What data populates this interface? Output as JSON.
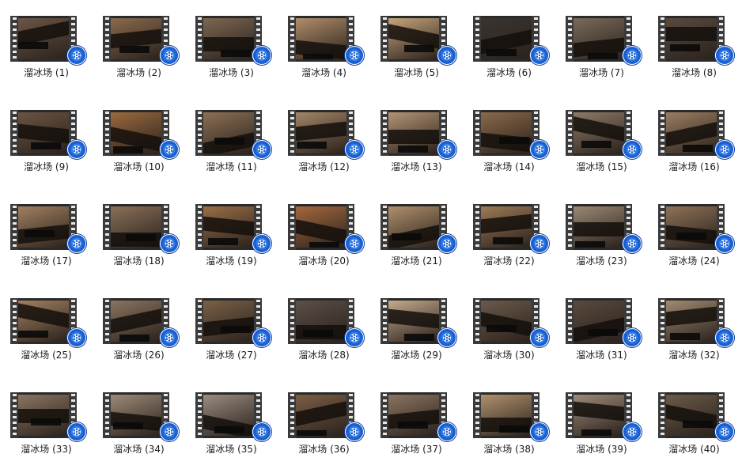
{
  "files": [
    {
      "label": "溜冰场 (1)",
      "tone": "#6b5646"
    },
    {
      "label": "溜冰场 (2)",
      "tone": "#8a6a4e"
    },
    {
      "label": "溜冰场 (3)",
      "tone": "#7c6652"
    },
    {
      "label": "溜冰场 (4)",
      "tone": "#b08d6a"
    },
    {
      "label": "溜冰场 (5)",
      "tone": "#c6a47c"
    },
    {
      "label": "溜冰场 (6)",
      "tone": "#3a3430"
    },
    {
      "label": "溜冰场 (7)",
      "tone": "#7a6a5a"
    },
    {
      "label": "溜冰场 (8)",
      "tone": "#5a4a3e"
    },
    {
      "label": "溜冰场 (9)",
      "tone": "#6a5444"
    },
    {
      "label": "溜冰场 (10)",
      "tone": "#9a6a3e"
    },
    {
      "label": "溜冰场 (11)",
      "tone": "#8c7056"
    },
    {
      "label": "溜冰场 (12)",
      "tone": "#a28566"
    },
    {
      "label": "溜冰场 (13)",
      "tone": "#b39474"
    },
    {
      "label": "溜冰场 (14)",
      "tone": "#8a6a4a"
    },
    {
      "label": "溜冰场 (15)",
      "tone": "#8d7a68"
    },
    {
      "label": "溜冰场 (16)",
      "tone": "#9b7e62"
    },
    {
      "label": "溜冰场 (17)",
      "tone": "#a08060"
    },
    {
      "label": "溜冰场 (18)",
      "tone": "#8a7058"
    },
    {
      "label": "溜冰场 (19)",
      "tone": "#9a6e46"
    },
    {
      "label": "溜冰场 (20)",
      "tone": "#a3683e"
    },
    {
      "label": "溜冰场 (21)",
      "tone": "#b0906c"
    },
    {
      "label": "溜冰场 (22)",
      "tone": "#9c7a56"
    },
    {
      "label": "溜冰场 (23)",
      "tone": "#9a8874"
    },
    {
      "label": "溜冰场 (24)",
      "tone": "#8d7258"
    },
    {
      "label": "溜冰场 (25)",
      "tone": "#a0805e"
    },
    {
      "label": "溜冰场 (26)",
      "tone": "#8a7460"
    },
    {
      "label": "溜冰场 (27)",
      "tone": "#7a6048"
    },
    {
      "label": "溜冰场 (28)",
      "tone": "#5c5048"
    },
    {
      "label": "溜冰场 (29)",
      "tone": "#c4aa8c"
    },
    {
      "label": "溜冰场 (30)",
      "tone": "#6c5a4c"
    },
    {
      "label": "溜冰场 (31)",
      "tone": "#5a4a3e"
    },
    {
      "label": "溜冰场 (32)",
      "tone": "#a08a72"
    },
    {
      "label": "溜冰场 (33)",
      "tone": "#8a7460"
    },
    {
      "label": "溜冰场 (34)",
      "tone": "#9c8a78"
    },
    {
      "label": "溜冰场 (35)",
      "tone": "#9a8c80"
    },
    {
      "label": "溜冰场 (36)",
      "tone": "#7a5e46"
    },
    {
      "label": "溜冰场 (37)",
      "tone": "#8a7460"
    },
    {
      "label": "溜冰场 (38)",
      "tone": "#b0916e"
    },
    {
      "label": "溜冰场 (39)",
      "tone": "#9c8a78"
    },
    {
      "label": "溜冰场 (40)",
      "tone": "#6a5a48"
    }
  ],
  "badge_icon": "media-player-reel-icon",
  "colors": {
    "badge": "#1a5fd0",
    "text": "#1a1a1a",
    "film": "#3a3a3a"
  }
}
